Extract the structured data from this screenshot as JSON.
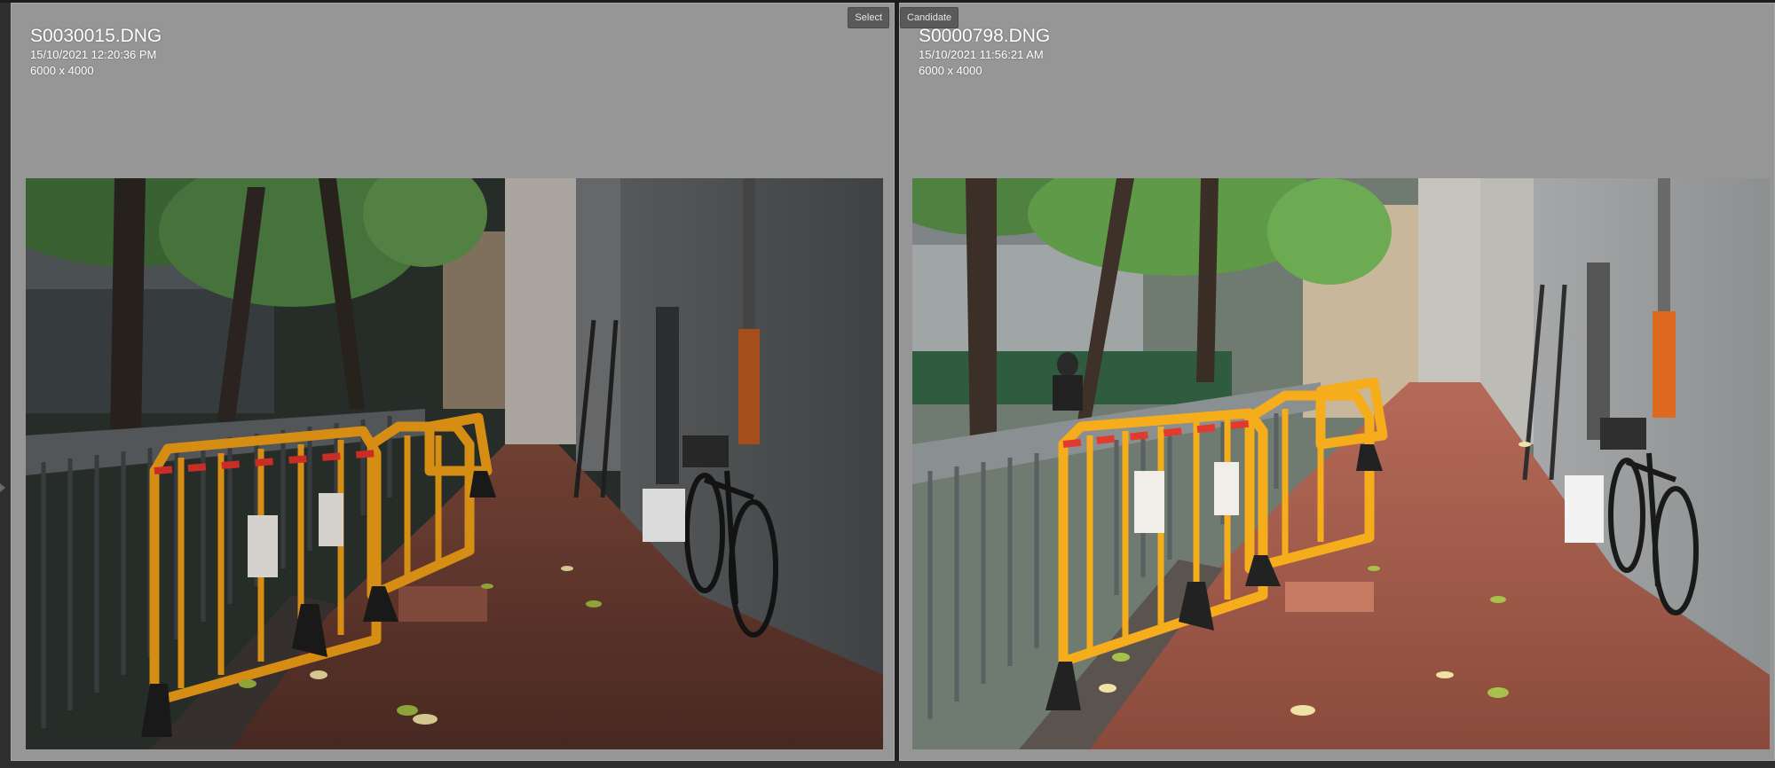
{
  "left_pane": {
    "tag_label": "Select",
    "filename": "S0030015.DNG",
    "datetime": "15/10/2021 12:20:36 PM",
    "dimensions": "6000 x 4000"
  },
  "right_pane": {
    "tag_label": "Candidate",
    "filename": "S0000798.DNG",
    "datetime": "15/10/2021 11:56:21 AM",
    "dimensions": "6000 x 4000"
  },
  "colors": {
    "pane_background": "#969696",
    "app_background": "#2b2b2b",
    "tag_background": "#5a5a5a",
    "barrier_orange": "#f0a010"
  }
}
